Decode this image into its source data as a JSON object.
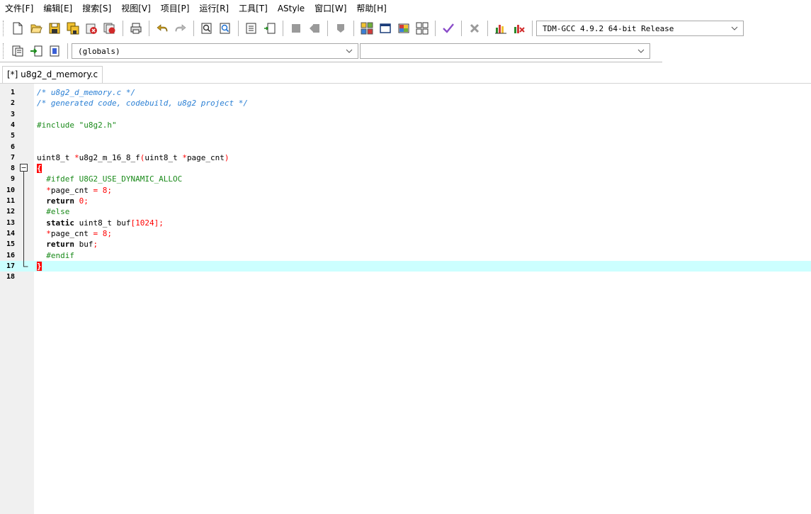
{
  "menu": [
    "文件[F]",
    "编辑[E]",
    "搜索[S]",
    "视图[V]",
    "项目[P]",
    "运行[R]",
    "工具[T]",
    "AStyle",
    "窗口[W]",
    "帮助[H]"
  ],
  "toolbar": {
    "compiler": "TDM-GCC 4.9.2 64-bit Release",
    "scope": "(globals)",
    "function": ""
  },
  "tab": {
    "label": "[*] u8g2_d_memory.c"
  },
  "editor": {
    "current_line": 17,
    "lines": [
      {
        "n": "1",
        "tokens": [
          {
            "t": "/* u8g2_d_memory.c */",
            "c": "comment"
          }
        ]
      },
      {
        "n": "2",
        "tokens": [
          {
            "t": "/* generated code, codebuild, u8g2 project */",
            "c": "comment"
          }
        ]
      },
      {
        "n": "3",
        "tokens": []
      },
      {
        "n": "4",
        "tokens": [
          {
            "t": "#include \"u8g2.h\"",
            "c": "pre"
          }
        ]
      },
      {
        "n": "5",
        "tokens": []
      },
      {
        "n": "6",
        "tokens": []
      },
      {
        "n": "7",
        "tokens": [
          {
            "t": "uint8_t ",
            "c": ""
          },
          {
            "t": "*",
            "c": "sym"
          },
          {
            "t": "u8g2_m_16_8_f",
            "c": ""
          },
          {
            "t": "(",
            "c": "sym"
          },
          {
            "t": "uint8_t ",
            "c": ""
          },
          {
            "t": "*",
            "c": "sym"
          },
          {
            "t": "page_cnt",
            "c": ""
          },
          {
            "t": ")",
            "c": "sym"
          }
        ]
      },
      {
        "n": "8",
        "tokens": [
          {
            "t": "{",
            "c": "brace"
          }
        ]
      },
      {
        "n": "9",
        "tokens": [
          {
            "t": "  #ifdef U8G2_USE_DYNAMIC_ALLOC",
            "c": "pre"
          }
        ]
      },
      {
        "n": "10",
        "tokens": [
          {
            "t": "  ",
            "c": ""
          },
          {
            "t": "*",
            "c": "sym"
          },
          {
            "t": "page_cnt ",
            "c": ""
          },
          {
            "t": "=",
            "c": "sym"
          },
          {
            "t": " ",
            "c": ""
          },
          {
            "t": "8",
            "c": "num"
          },
          {
            "t": ";",
            "c": "sym"
          }
        ]
      },
      {
        "n": "11",
        "tokens": [
          {
            "t": "  ",
            "c": ""
          },
          {
            "t": "return",
            "c": "kw"
          },
          {
            "t": " ",
            "c": ""
          },
          {
            "t": "0",
            "c": "num"
          },
          {
            "t": ";",
            "c": "sym"
          }
        ]
      },
      {
        "n": "12",
        "tokens": [
          {
            "t": "  #else",
            "c": "pre"
          }
        ]
      },
      {
        "n": "13",
        "tokens": [
          {
            "t": "  ",
            "c": ""
          },
          {
            "t": "static",
            "c": "kw"
          },
          {
            "t": " uint8_t buf",
            "c": ""
          },
          {
            "t": "[",
            "c": "sym"
          },
          {
            "t": "1024",
            "c": "num"
          },
          {
            "t": "];",
            "c": "sym"
          }
        ]
      },
      {
        "n": "14",
        "tokens": [
          {
            "t": "  ",
            "c": ""
          },
          {
            "t": "*",
            "c": "sym"
          },
          {
            "t": "page_cnt ",
            "c": ""
          },
          {
            "t": "=",
            "c": "sym"
          },
          {
            "t": " ",
            "c": ""
          },
          {
            "t": "8",
            "c": "num"
          },
          {
            "t": ";",
            "c": "sym"
          }
        ]
      },
      {
        "n": "15",
        "tokens": [
          {
            "t": "  ",
            "c": ""
          },
          {
            "t": "return",
            "c": "kw"
          },
          {
            "t": " buf",
            "c": ""
          },
          {
            "t": ";",
            "c": "sym"
          }
        ]
      },
      {
        "n": "16",
        "tokens": [
          {
            "t": "  #endif",
            "c": "pre"
          }
        ]
      },
      {
        "n": "17",
        "tokens": [
          {
            "t": "}",
            "c": "brace"
          }
        ]
      },
      {
        "n": "18",
        "tokens": []
      }
    ]
  },
  "colors": {
    "comment": "#2a7fd4",
    "preprocessor": "#1a8a1a",
    "symbol": "#ff0000",
    "current_line": "#ccffff",
    "gutter": "#f0f0f0"
  }
}
